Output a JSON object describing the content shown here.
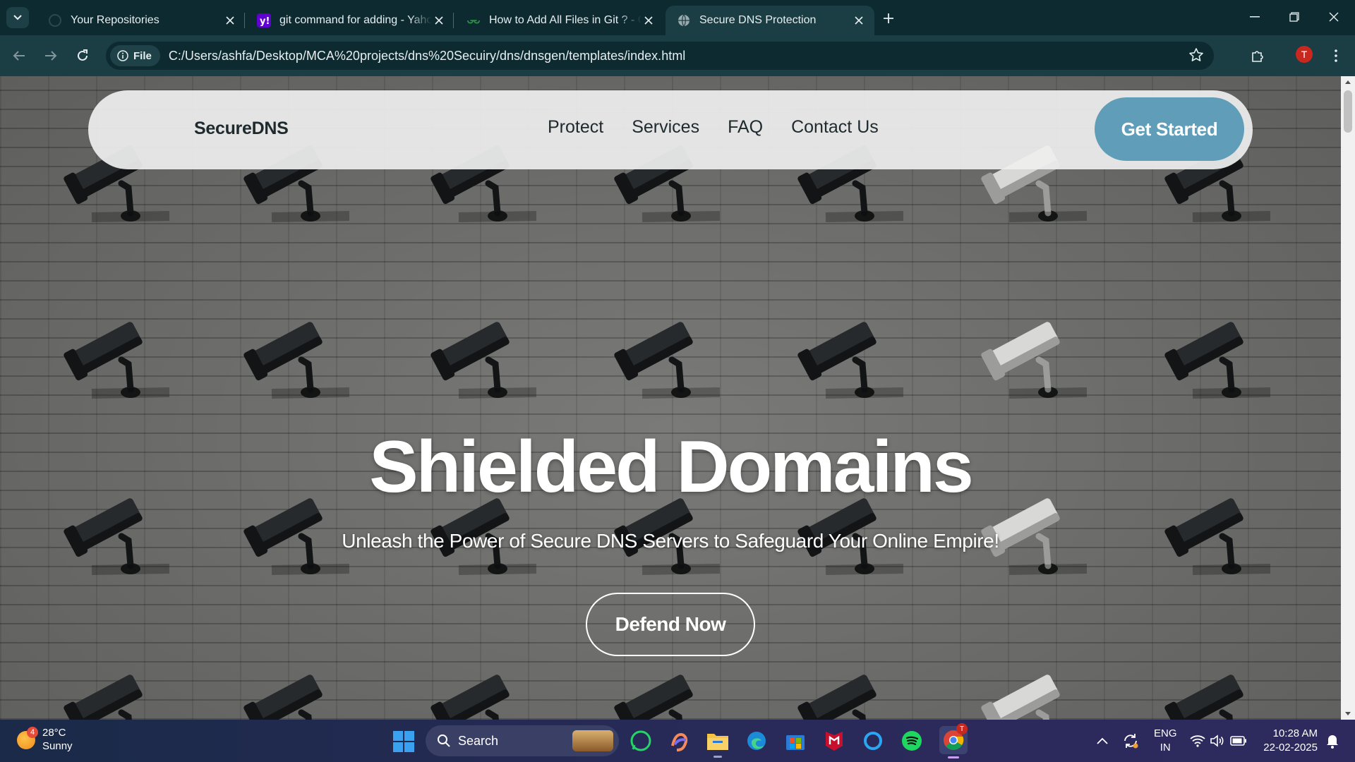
{
  "browser": {
    "tabs": [
      {
        "title": "Your Repositories",
        "icon": "github-icon",
        "active": false
      },
      {
        "title": "git command for adding - Yahoo",
        "icon": "yahoo-icon",
        "active": false
      },
      {
        "title": "How to Add All Files in Git ? - G",
        "icon": "geeksforgeeks-icon",
        "active": false
      },
      {
        "title": "Secure DNS Protection",
        "icon": "globe-icon",
        "active": true
      }
    ],
    "address": {
      "scheme_chip": "File",
      "url": "C:/Users/ashfa/Desktop/MCA%20projects/dns%20Secuiry/dns/dnsgen/templates/index.html"
    },
    "profile_initial": "T"
  },
  "site": {
    "brand": "SecureDNS",
    "nav": [
      "Protect",
      "Services",
      "FAQ",
      "Contact Us"
    ],
    "cta": "Get Started",
    "hero": {
      "title": "Shielded Domains",
      "subtitle": "Unleash the Power of Secure DNS Servers to Safeguard Your Online Empire!",
      "button": "Defend Now"
    }
  },
  "taskbar": {
    "weather": {
      "temp": "28°C",
      "condition": "Sunny",
      "badge": "4"
    },
    "search_label": "Search",
    "language": {
      "line1": "ENG",
      "line2": "IN"
    },
    "clock": {
      "time": "10:28 AM",
      "date": "22-02-2025"
    },
    "chrome_badge": "T"
  },
  "colors": {
    "accent_button": "#5f9db8",
    "browser_frame": "#0c2a30",
    "toolbar": "#1b3d44"
  }
}
